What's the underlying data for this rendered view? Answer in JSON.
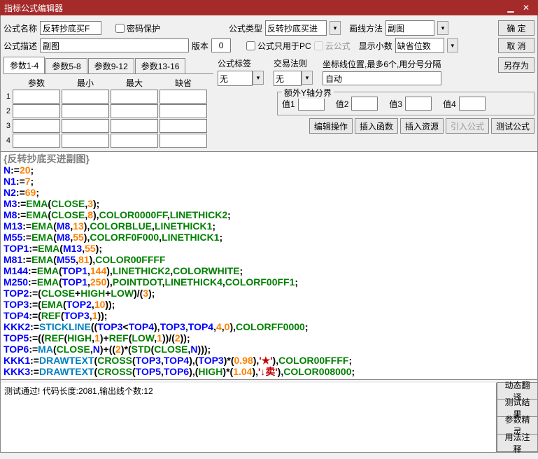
{
  "window": {
    "title": "指标公式编辑器"
  },
  "labels": {
    "formula_name": "公式名称",
    "password_protect": "密码保护",
    "formula_type": "公式类型",
    "draw_method": "画线方法",
    "formula_desc": "公式描述",
    "version": "版本",
    "pc_only": "公式只用于PC",
    "cloud_formula": "云公式",
    "show_decimal": "显示小数",
    "formula_label": "公式标签",
    "trade_rule": "交易法则",
    "coord_hint": "坐标线位置,最多6个,用分号分隔",
    "extra_y": "额外Y轴分界",
    "val1": "值1",
    "val2": "值2",
    "val3": "值3",
    "val4": "值4"
  },
  "values": {
    "formula_name": "反转抄底买F",
    "formula_type": "反转抄底买进",
    "draw_method": "副图",
    "formula_desc": "副图",
    "version": "0",
    "show_decimal": "缺省位数",
    "formula_label_sel": "无",
    "trade_rule_sel": "无",
    "coord_input": "自动"
  },
  "buttons": {
    "ok": "确 定",
    "cancel": "取 消",
    "saveas": "另存为",
    "edit_op": "编辑操作",
    "insert_func": "插入函数",
    "insert_res": "插入资源",
    "import_formula": "引入公式",
    "test_formula": "测试公式",
    "dyn_trans": "动态翻译",
    "test_result": "测试结果",
    "param_wizard": "参数精灵",
    "usage_note": "用法注释"
  },
  "tabs": {
    "params": [
      "参数1-4",
      "参数5-8",
      "参数9-12",
      "参数13-16"
    ],
    "headers": [
      "参数",
      "最小",
      "最大",
      "缺省"
    ]
  },
  "code_header": "{反转抄底买进副图}",
  "status_msg": "测试通过! 代码长度:2081,输出线个数:12"
}
